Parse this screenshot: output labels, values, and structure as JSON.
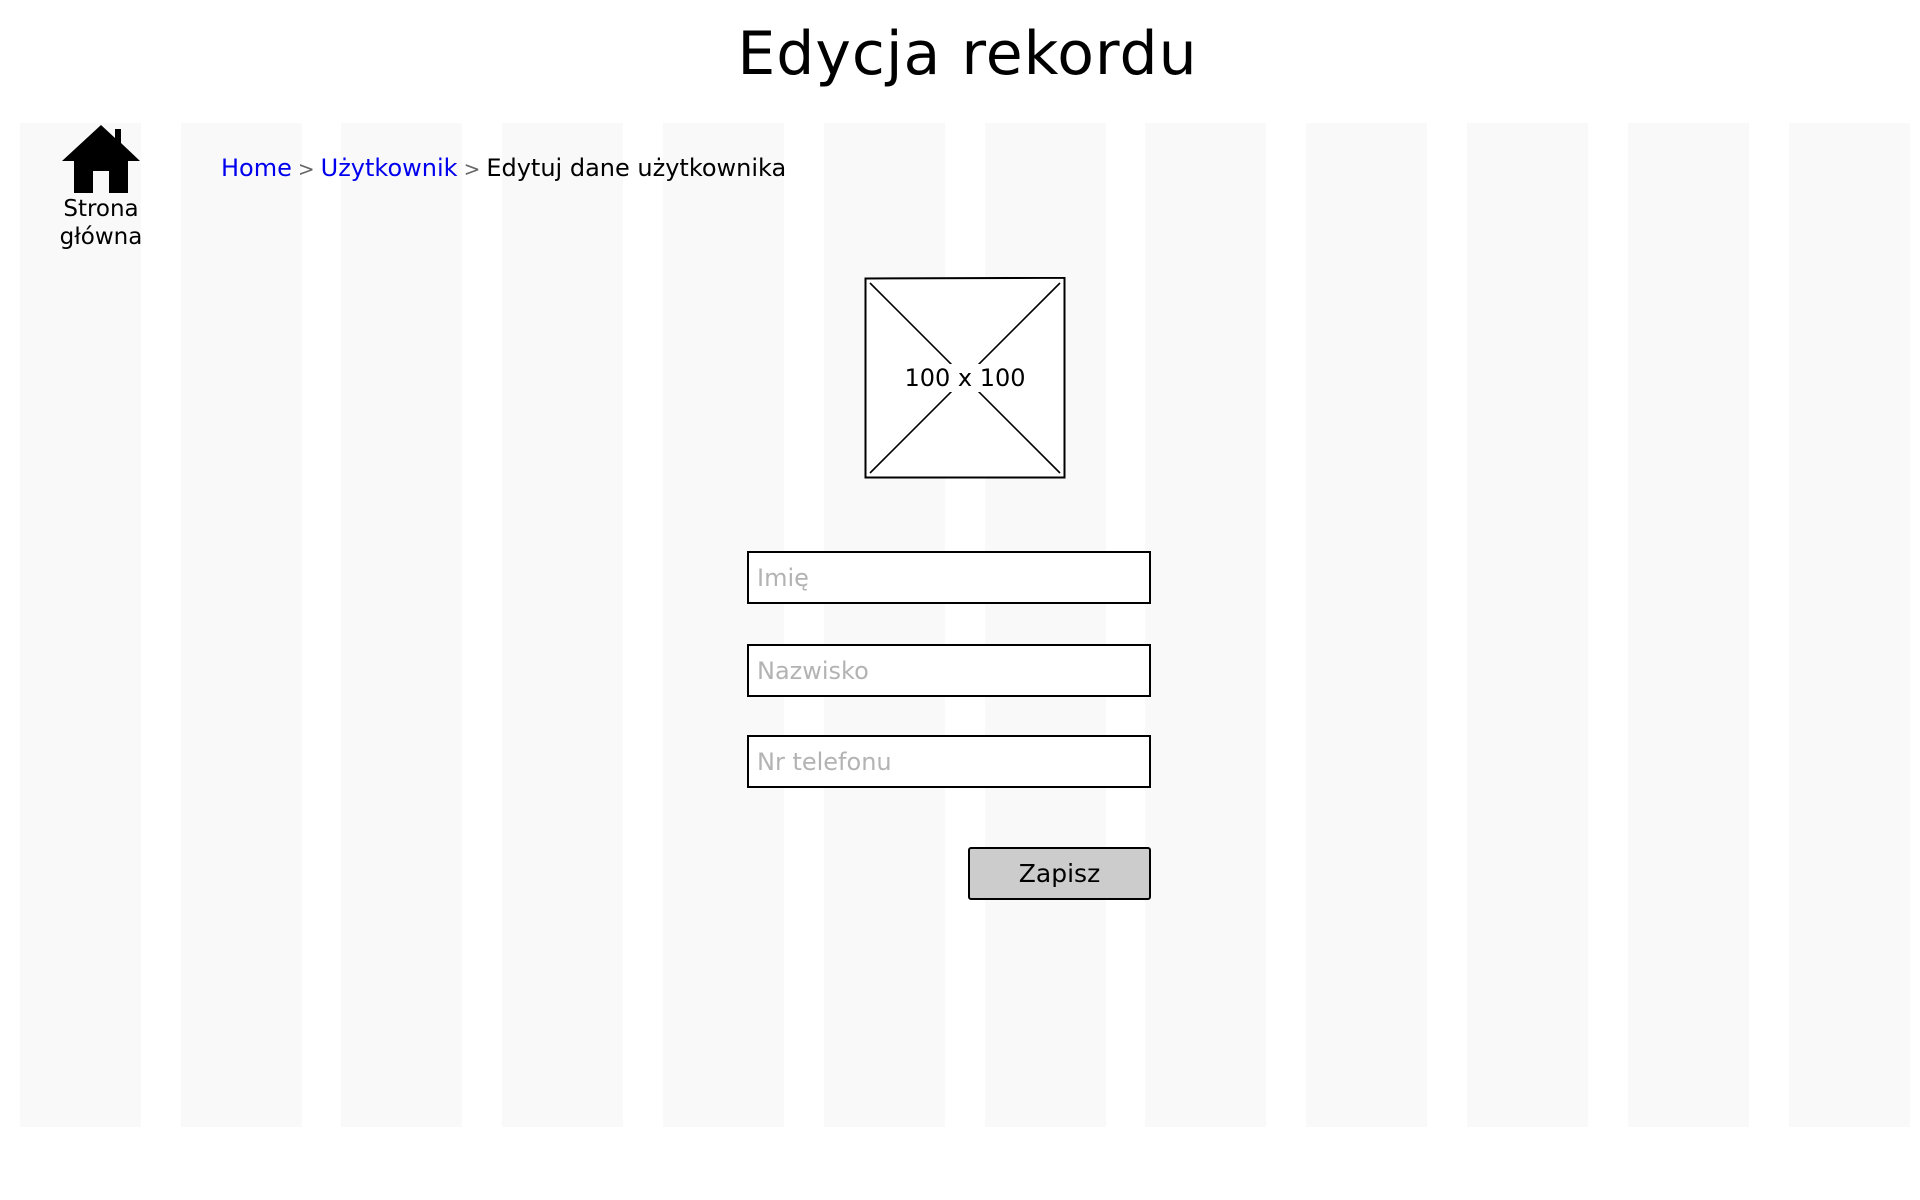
{
  "page": {
    "title": "Edycja rekordu"
  },
  "home": {
    "label": "Strona główna",
    "icon": "home-icon"
  },
  "breadcrumb": {
    "items": [
      {
        "label": "Home",
        "link": true
      },
      {
        "label": "Użytkownik",
        "link": true
      },
      {
        "label": "Edytuj dane użytkownika",
        "link": false
      }
    ],
    "separator": ">",
    "link_color": "#0000ee"
  },
  "image_placeholder": {
    "label": "100 x 100"
  },
  "form": {
    "first_name": {
      "placeholder": "Imię",
      "value": ""
    },
    "last_name": {
      "placeholder": "Nazwisko",
      "value": ""
    },
    "phone": {
      "placeholder": "Nr telefonu",
      "value": ""
    },
    "save_label": "Zapisz"
  },
  "colors": {
    "background": "#ffffff",
    "grid_column": "#f9f9f9",
    "button": "#cccccc",
    "placeholder_text": "#b3b3b3"
  }
}
